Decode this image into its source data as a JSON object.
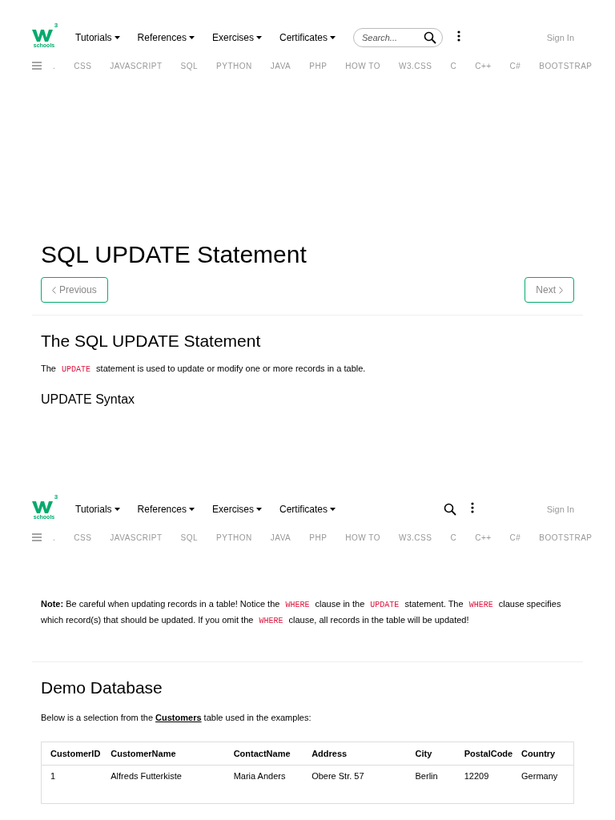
{
  "headers": [
    {
      "menus": [
        "Tutorials",
        "References",
        "Exercises",
        "Certificates"
      ],
      "search": {
        "placeholder": "Search..."
      },
      "sign_in": "Sign In",
      "logo_sub": "schools",
      "logo_sup": "3",
      "subnav": [
        ".",
        "CSS",
        "JAVASCRIPT",
        "SQL",
        "PYTHON",
        "JAVA",
        "PHP",
        "HOW TO",
        "W3.CSS",
        "C",
        "C++",
        "C#",
        "BOOTSTRAP"
      ]
    },
    {
      "menus": [
        "Tutorials",
        "References",
        "Exercises",
        "Certificates"
      ],
      "sign_in": "Sign In",
      "logo_sub": "schools",
      "logo_sup": "3",
      "subnav": [
        ".",
        "CSS",
        "JAVASCRIPT",
        "SQL",
        "PYTHON",
        "JAVA",
        "PHP",
        "HOW TO",
        "W3.CSS",
        "C",
        "C++",
        "C#",
        "BOOTSTRAP"
      ]
    }
  ],
  "title": "SQL UPDATE Statement",
  "pager": {
    "previous": "Previous",
    "next": "Next"
  },
  "section1": {
    "heading": "The SQL UPDATE Statement",
    "intro": [
      {
        "kind": "text",
        "text": "The "
      },
      {
        "kind": "code",
        "text": "UPDATE"
      },
      {
        "kind": "text",
        "text": " statement is used to update or modify one or more records in a table."
      }
    ],
    "subheading": "UPDATE Syntax"
  },
  "note": [
    {
      "kind": "bold",
      "text": "Note:"
    },
    {
      "kind": "text",
      "text": " Be careful when updating records in a table! Notice the "
    },
    {
      "kind": "code",
      "text": "WHERE"
    },
    {
      "kind": "text",
      "text": " clause in the "
    },
    {
      "kind": "code",
      "text": "UPDATE"
    },
    {
      "kind": "text",
      "text": " statement. The "
    },
    {
      "kind": "code",
      "text": "WHERE"
    },
    {
      "kind": "text",
      "text": " clause specifies which record(s) that should be updated. If you omit the "
    },
    {
      "kind": "code",
      "text": "WHERE"
    },
    {
      "kind": "text",
      "text": " clause, all records in the table will be updated!"
    }
  ],
  "demo": {
    "heading": "Demo Database",
    "intro_before": "Below is a selection from the ",
    "intro_link": "Customers",
    "intro_after": " table used in the examples:"
  },
  "table": {
    "columns": [
      "CustomerID",
      "CustomerName",
      "ContactName",
      "Address",
      "City",
      "PostalCode",
      "Country"
    ],
    "rows": [
      [
        "1",
        "Alfreds Futterkiste",
        "Maria Anders",
        "Obere Str. 57",
        "Berlin",
        "12209",
        "Germany"
      ]
    ]
  }
}
